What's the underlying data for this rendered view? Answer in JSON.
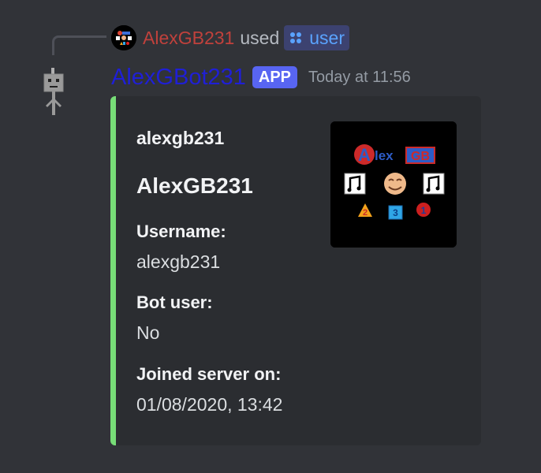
{
  "interaction": {
    "username": "AlexGB231",
    "used_text": "used",
    "command_icon": "slash-command-icon",
    "command_name": "user"
  },
  "message": {
    "author": "AlexGBot231",
    "badge": "APP",
    "timestamp": "Today at 11:56"
  },
  "embed": {
    "accent_color": "#77dd77",
    "author": "alexgb231",
    "title": "AlexGB231",
    "fields": [
      {
        "name": "Username:",
        "value": "alexgb231"
      },
      {
        "name": "Bot user:",
        "value": "No"
      },
      {
        "name": "Joined server on:",
        "value": "01/08/2020, 13:42"
      }
    ],
    "thumbnail": {
      "logo_text": [
        "A",
        "lex",
        "GB"
      ],
      "digits": [
        "2",
        "3",
        "1"
      ]
    }
  },
  "colors": {
    "background": "#313338",
    "embed_background": "#2b2d31",
    "reply_username": "#c0413c",
    "bot_name": "#1f1fd6",
    "badge": "#5865f2"
  }
}
